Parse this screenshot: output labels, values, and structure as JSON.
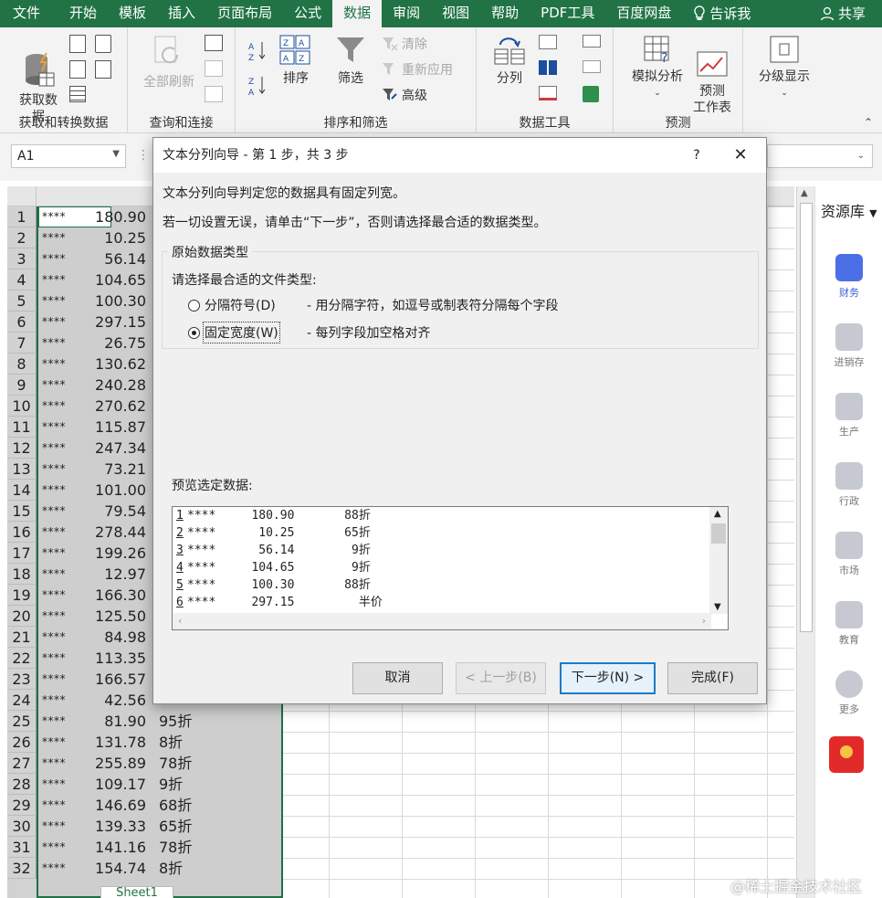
{
  "ribbon": {
    "tabs": [
      {
        "label": "文件"
      },
      {
        "label": "开始"
      },
      {
        "label": "模板"
      },
      {
        "label": "插入"
      },
      {
        "label": "页面布局"
      },
      {
        "label": "公式"
      },
      {
        "label": "数据",
        "active": true
      },
      {
        "label": "审阅"
      },
      {
        "label": "视图"
      },
      {
        "label": "帮助"
      },
      {
        "label": "PDF工具"
      },
      {
        "label": "百度网盘"
      }
    ],
    "tell_me": "告诉我",
    "share": "共享",
    "groups": {
      "get_transform": {
        "label": "获取和转换数据",
        "get_data": "获取数\n据"
      },
      "queries": {
        "label": "查询和连接",
        "refresh_all": "全部刷新"
      },
      "sort_filter": {
        "label": "排序和筛选",
        "sort": "排序",
        "filter": "筛选",
        "clear": "清除",
        "reapply": "重新应用",
        "advanced": "高级"
      },
      "data_tools": {
        "label": "数据工具",
        "text_to_columns": "分列"
      },
      "forecast": {
        "label": "预测",
        "what_if": "模拟分析",
        "forecast_sheet": "预测\n工作表"
      },
      "outline": {
        "label": "分级显示"
      }
    }
  },
  "formula_bar": {
    "name_box": "A1"
  },
  "grid": {
    "rows": [
      {
        "n": "1",
        "a": "****",
        "b": "180.90",
        "c": ""
      },
      {
        "n": "2",
        "a": "****",
        "b": "10.25",
        "c": ""
      },
      {
        "n": "3",
        "a": "****",
        "b": "56.14",
        "c": ""
      },
      {
        "n": "4",
        "a": "****",
        "b": "104.65",
        "c": ""
      },
      {
        "n": "5",
        "a": "****",
        "b": "100.30",
        "c": ""
      },
      {
        "n": "6",
        "a": "****",
        "b": "297.15",
        "c": ""
      },
      {
        "n": "7",
        "a": "****",
        "b": "26.75",
        "c": ""
      },
      {
        "n": "8",
        "a": "****",
        "b": "130.62",
        "c": ""
      },
      {
        "n": "9",
        "a": "****",
        "b": "240.28",
        "c": ""
      },
      {
        "n": "10",
        "a": "****",
        "b": "270.62",
        "c": ""
      },
      {
        "n": "11",
        "a": "****",
        "b": "115.87",
        "c": ""
      },
      {
        "n": "12",
        "a": "****",
        "b": "247.34",
        "c": ""
      },
      {
        "n": "13",
        "a": "****",
        "b": "73.21",
        "c": ""
      },
      {
        "n": "14",
        "a": "****",
        "b": "101.00",
        "c": ""
      },
      {
        "n": "15",
        "a": "****",
        "b": "79.54",
        "c": ""
      },
      {
        "n": "16",
        "a": "****",
        "b": "278.44",
        "c": ""
      },
      {
        "n": "17",
        "a": "****",
        "b": "199.26",
        "c": ""
      },
      {
        "n": "18",
        "a": "****",
        "b": "12.97",
        "c": ""
      },
      {
        "n": "19",
        "a": "****",
        "b": "166.30",
        "c": ""
      },
      {
        "n": "20",
        "a": "****",
        "b": "125.50",
        "c": ""
      },
      {
        "n": "21",
        "a": "****",
        "b": "84.98",
        "c": ""
      },
      {
        "n": "22",
        "a": "****",
        "b": "113.35",
        "c": ""
      },
      {
        "n": "23",
        "a": "****",
        "b": "166.57",
        "c": ""
      },
      {
        "n": "24",
        "a": "****",
        "b": "42.56",
        "c": ""
      },
      {
        "n": "25",
        "a": "****",
        "b": "81.90",
        "c": "95折"
      },
      {
        "n": "26",
        "a": "****",
        "b": "131.78",
        "c": "8折"
      },
      {
        "n": "27",
        "a": "****",
        "b": "255.89",
        "c": "78折"
      },
      {
        "n": "28",
        "a": "****",
        "b": "109.17",
        "c": "9折"
      },
      {
        "n": "29",
        "a": "****",
        "b": "146.69",
        "c": "68折"
      },
      {
        "n": "30",
        "a": "****",
        "b": "139.33",
        "c": "65折"
      },
      {
        "n": "31",
        "a": "****",
        "b": "141.16",
        "c": "78折"
      },
      {
        "n": "32",
        "a": "****",
        "b": "154.74",
        "c": "8折"
      }
    ],
    "sheet_tab": "Sheet1"
  },
  "resource_pane": {
    "title": "资源库",
    "items": [
      {
        "label": "财务",
        "active": true
      },
      {
        "label": "进销存"
      },
      {
        "label": "生产"
      },
      {
        "label": "行政"
      },
      {
        "label": "市场"
      },
      {
        "label": "教育"
      },
      {
        "label": "更多"
      }
    ]
  },
  "dialog": {
    "title": "文本分列向导 - 第 1 步，共 3 步",
    "help": "?",
    "intro1": "文本分列向导判定您的数据具有固定列宽。",
    "intro2": "若一切设置无误，请单击“下一步”，否则请选择最合适的数据类型。",
    "group_title": "原始数据类型",
    "choose_label": "请选择最合适的文件类型:",
    "option_delimited": "分隔符号(D)",
    "option_delimited_desc": "- 用分隔字符，如逗号或制表符分隔每个字段",
    "option_fixed": "固定宽度(W)",
    "option_fixed_desc": "- 每列字段加空格对齐",
    "preview_label": "预览选定数据:",
    "preview_lines": [
      {
        "n": "1",
        "text": "****     180.90       88折"
      },
      {
        "n": "2",
        "text": "****      10.25       65折"
      },
      {
        "n": "3",
        "text": "****      56.14        9折"
      },
      {
        "n": "4",
        "text": "****     104.65        9折"
      },
      {
        "n": "5",
        "text": "****     100.30       88折"
      },
      {
        "n": "6",
        "text": "****     297.15         半价"
      }
    ],
    "buttons": {
      "cancel": "取消",
      "back": "< 上一步(B)",
      "next": "下一步(N) >",
      "finish": "完成(F)"
    }
  },
  "watermark": "@稀土掘金技术社区",
  "colors": {
    "excel_green": "#217346",
    "selection_border": "#1e7145",
    "default_button": "#1d7ac8"
  }
}
